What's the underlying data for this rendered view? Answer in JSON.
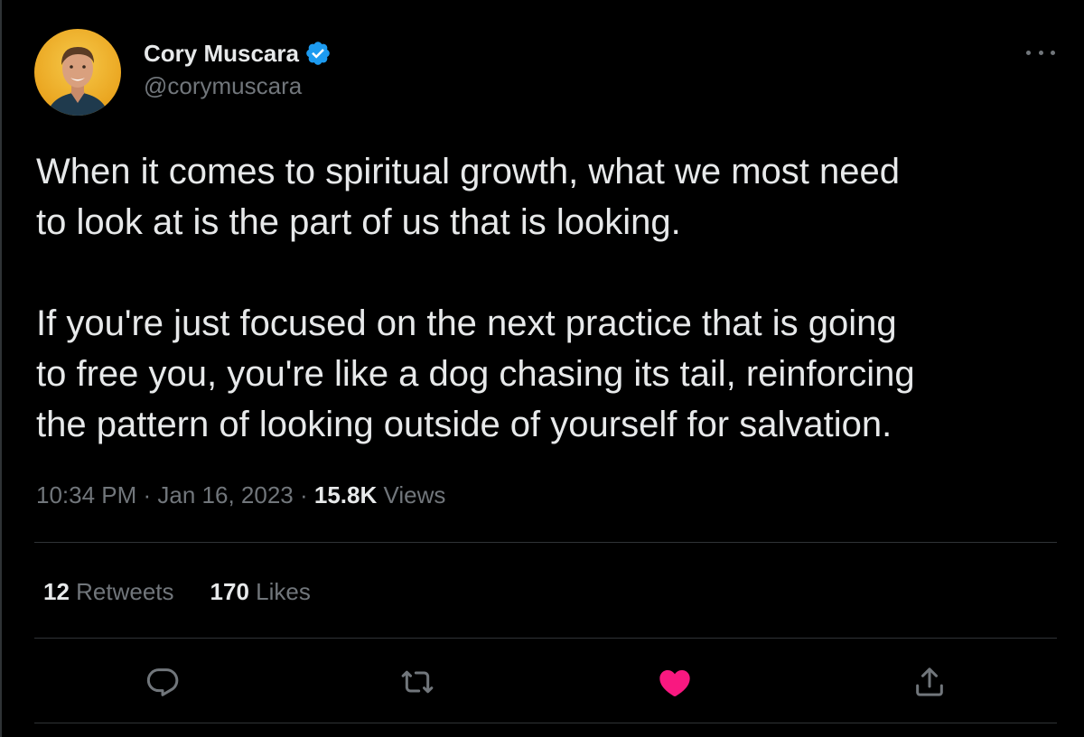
{
  "author": {
    "display_name": "Cory Muscara",
    "handle": "@corymuscara",
    "verified": true
  },
  "tweet": {
    "paragraph_1": [
      "When it comes to spiritual growth, what we most need",
      "to look at is the part of us that is looking."
    ],
    "paragraph_2": [
      "If you're just focused on the next practice that is going",
      "to free you, you're like a dog chasing its tail, reinforcing",
      "the pattern of looking outside of yourself for salvation."
    ]
  },
  "meta": {
    "time": "10:34 PM",
    "separator": " · ",
    "date": "Jan 16, 2023",
    "views_count": "15.8K",
    "views_label": " Views"
  },
  "stats": {
    "retweets_count": "12",
    "retweets_label": " Retweets",
    "likes_count": "170",
    "likes_label": " Likes"
  },
  "actions": [
    {
      "name": "reply",
      "icon": "reply-icon"
    },
    {
      "name": "retweet",
      "icon": "retweet-icon"
    },
    {
      "name": "like",
      "icon": "heart-icon",
      "active": true
    },
    {
      "name": "share",
      "icon": "share-icon"
    }
  ],
  "colors": {
    "background": "#000000",
    "text": "#e7e9ea",
    "secondary_text": "#71767b",
    "divider": "#2f3336",
    "verified_blue": "#1d9bf0",
    "like_pink": "#f91880"
  }
}
